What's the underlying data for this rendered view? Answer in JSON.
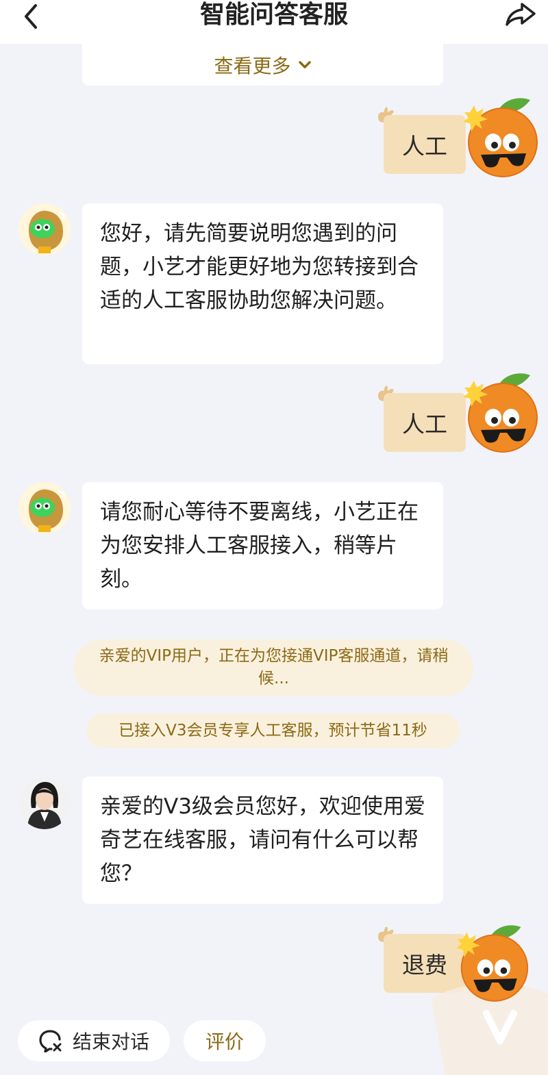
{
  "header": {
    "title": "智能问答客服"
  },
  "history": {
    "view_more_label": "查看更多"
  },
  "messages": [
    {
      "role": "user",
      "text": "人工"
    },
    {
      "role": "bot",
      "text": "您好，请先简要说明您遇到的问题，小艺才能更好地为您转接到合适的人工客服协助您解决问题。"
    },
    {
      "role": "user",
      "text": "人工"
    },
    {
      "role": "bot",
      "text": "请您耐心等待不要离线，小艺正在为您安排人工客服接入，稍等片刻。"
    },
    {
      "role": "system",
      "text": "亲爱的VIP用户，正在为您接通VIP客服通道，请稍候..."
    },
    {
      "role": "system",
      "text": "已接入V3会员专享人工客服，预计节省11秒"
    },
    {
      "role": "agent",
      "text": "亲爱的V3级会员您好，欢迎使用爱奇艺在线客服，请问有什么可以帮您？"
    },
    {
      "role": "user",
      "text": "退费"
    }
  ],
  "footer": {
    "end_chat_label": "结束对话",
    "rate_label": "评价"
  },
  "colors": {
    "background": "#f1f3f8",
    "user_bubble": "#f5dfb9",
    "notice_bg": "#faf0de",
    "accent_text": "#8a6a14"
  },
  "icons": [
    "back-arrow-icon",
    "share-icon",
    "chevron-down-icon",
    "orange-mascot-avatar",
    "robot-avatar",
    "agent-avatar",
    "end-chat-icon",
    "hand-icon"
  ]
}
